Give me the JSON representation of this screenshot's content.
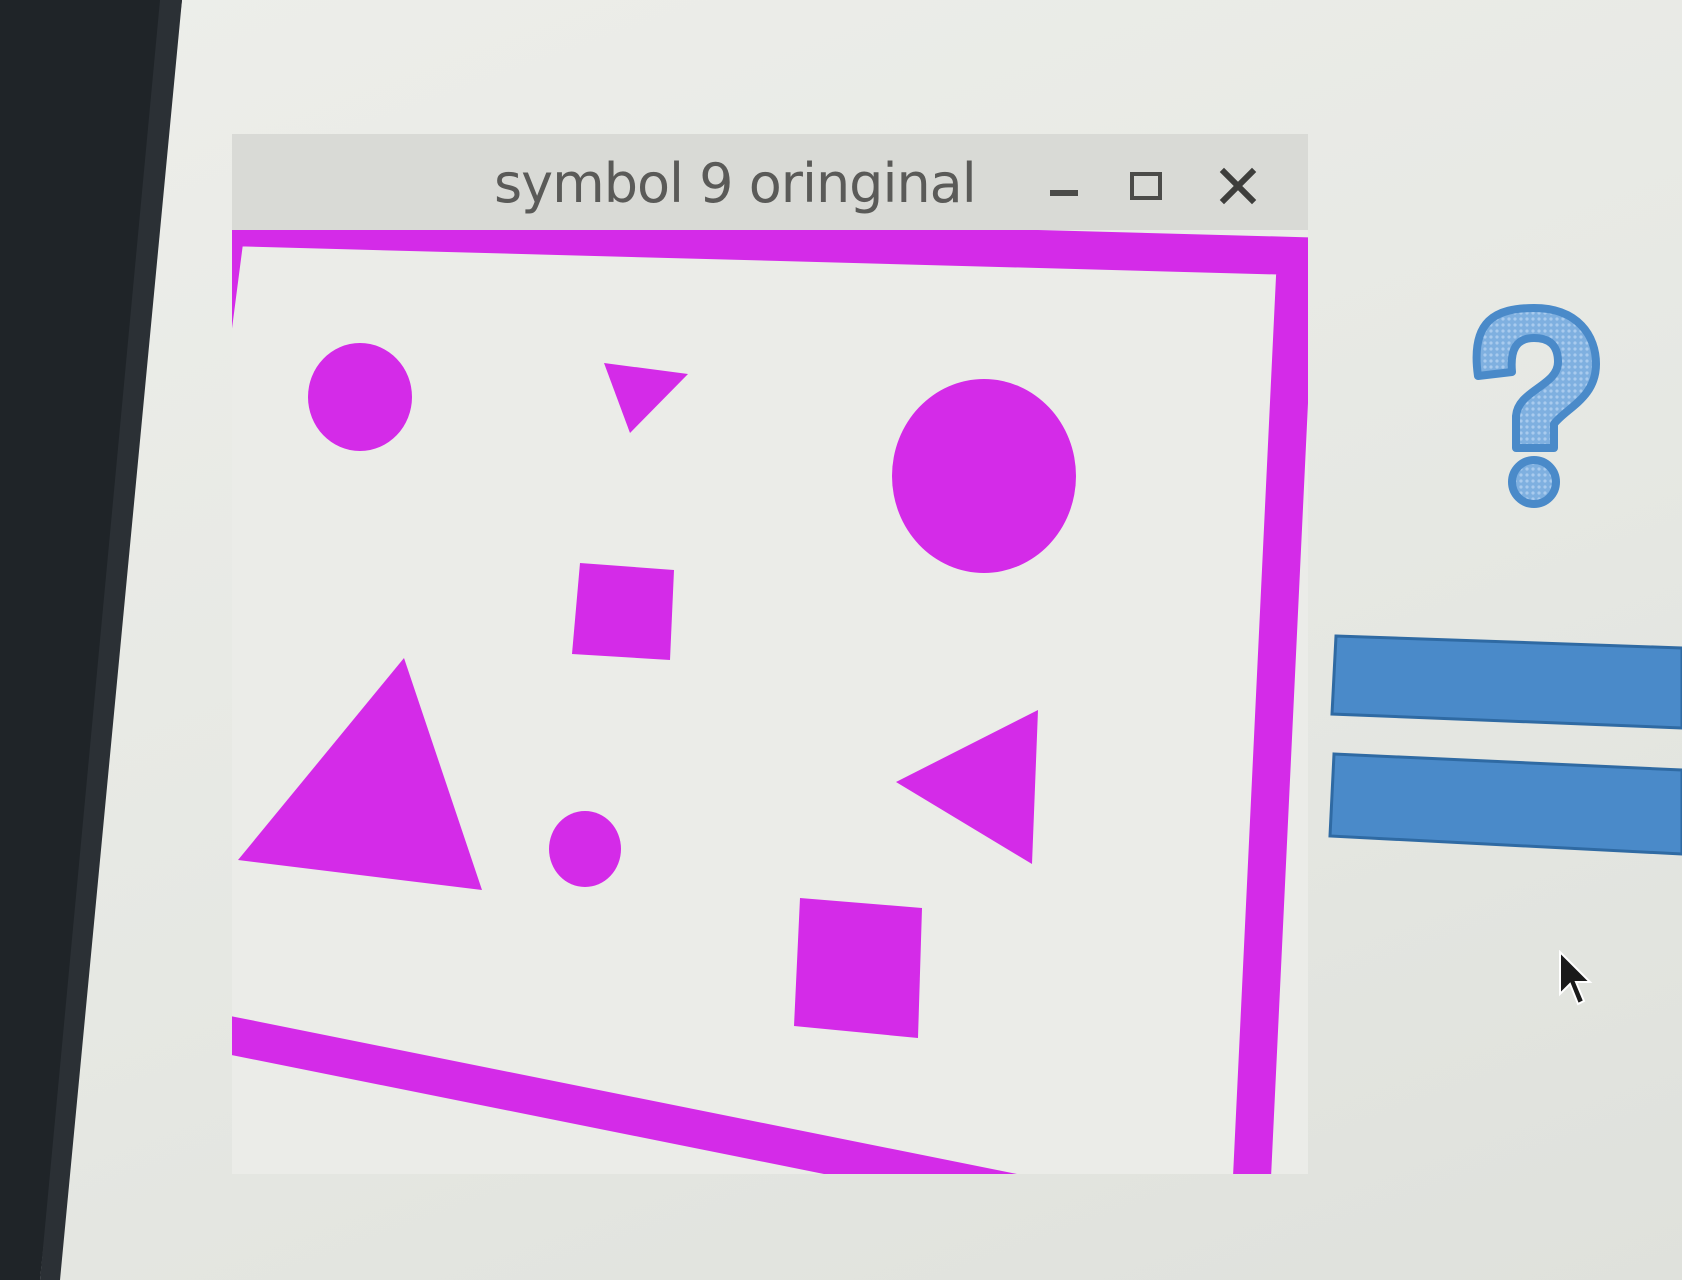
{
  "window": {
    "title": "symbol 9 oringinal",
    "controls": {
      "minimize_icon": "minimize-icon",
      "maximize_icon": "maximize-icon",
      "close_icon": "close-icon"
    }
  },
  "colors": {
    "shape_fill": "#d42be8",
    "frame": "#d42be8",
    "accent_blue": "#4a8ac9",
    "titlebar": "#d9dad6",
    "canvas_bg": "#ebece8"
  },
  "canvas": {
    "shapes": [
      {
        "kind": "circle",
        "name": "small-circle-top-left"
      },
      {
        "kind": "triangle",
        "name": "small-triangle-top"
      },
      {
        "kind": "circle",
        "name": "large-circle-top-right"
      },
      {
        "kind": "square",
        "name": "small-square-center"
      },
      {
        "kind": "triangle",
        "name": "large-triangle-bottom-left"
      },
      {
        "kind": "circle",
        "name": "small-circle-bottom"
      },
      {
        "kind": "triangle",
        "name": "left-pointing-triangle-right"
      },
      {
        "kind": "square",
        "name": "square-bottom-right"
      }
    ]
  },
  "side_panel": {
    "question_icon": "question-mark-icon",
    "equals_icon": "equals-sign-icon"
  }
}
